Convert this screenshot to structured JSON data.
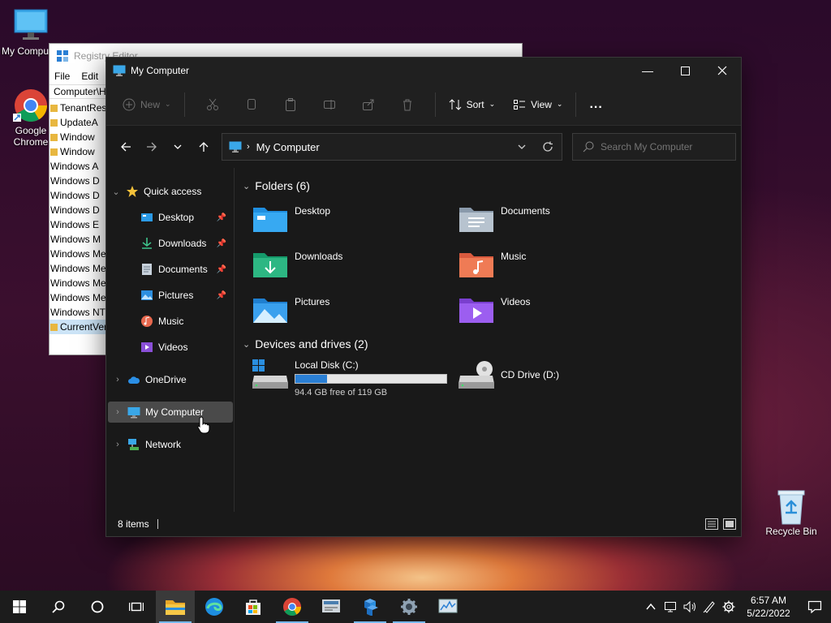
{
  "desktop": {
    "icons": [
      {
        "label": "My Computer",
        "icon": "monitor-icon"
      },
      {
        "label": "Google Chrome",
        "icon": "chrome-icon"
      },
      {
        "label": "Recycle Bin",
        "icon": "recycle-bin-icon"
      }
    ]
  },
  "registry": {
    "title": "Registry Editor",
    "menu": [
      "File",
      "Edit"
    ],
    "address": "Computer\\H",
    "tree": [
      "TenantRest",
      "UpdateA",
      "Window",
      "Window",
      "Windows A",
      "Windows D",
      "Windows D",
      "Windows D",
      "Windows E",
      "Windows M",
      "Windows Med",
      "Windows Med",
      "Windows Med",
      "Windows Mes",
      "Windows NT",
      "CurrentVer"
    ]
  },
  "explorer": {
    "title": "My Computer",
    "toolbar": {
      "new_label": "New",
      "sort_label": "Sort",
      "view_label": "View",
      "more_label": "..."
    },
    "address": "My Computer",
    "search_placeholder": "Search My Computer",
    "nav": {
      "quick_access": "Quick access",
      "items": [
        {
          "label": "Desktop",
          "pinned": true
        },
        {
          "label": "Downloads",
          "pinned": true
        },
        {
          "label": "Documents",
          "pinned": true
        },
        {
          "label": "Pictures",
          "pinned": true
        },
        {
          "label": "Music",
          "pinned": false
        },
        {
          "label": "Videos",
          "pinned": false
        }
      ],
      "onedrive": "OneDrive",
      "my_computer": "My Computer",
      "network": "Network"
    },
    "folders_header": "Folders (6)",
    "folders": [
      "Desktop",
      "Documents",
      "Downloads",
      "Music",
      "Pictures",
      "Videos"
    ],
    "drives_header": "Devices and drives (2)",
    "drives": [
      {
        "name": "Local Disk (C:)",
        "free": "94.4 GB free of 119 GB",
        "used_fraction": 0.207
      },
      {
        "name": "CD Drive (D:)"
      }
    ],
    "status": "8 items"
  },
  "taskbar": {
    "time": "6:57 AM",
    "date": "5/22/2022"
  },
  "colors": {
    "accent": "#2a7fd4",
    "window_bg": "#191919",
    "taskbar_bg": "#1c1c1c"
  }
}
